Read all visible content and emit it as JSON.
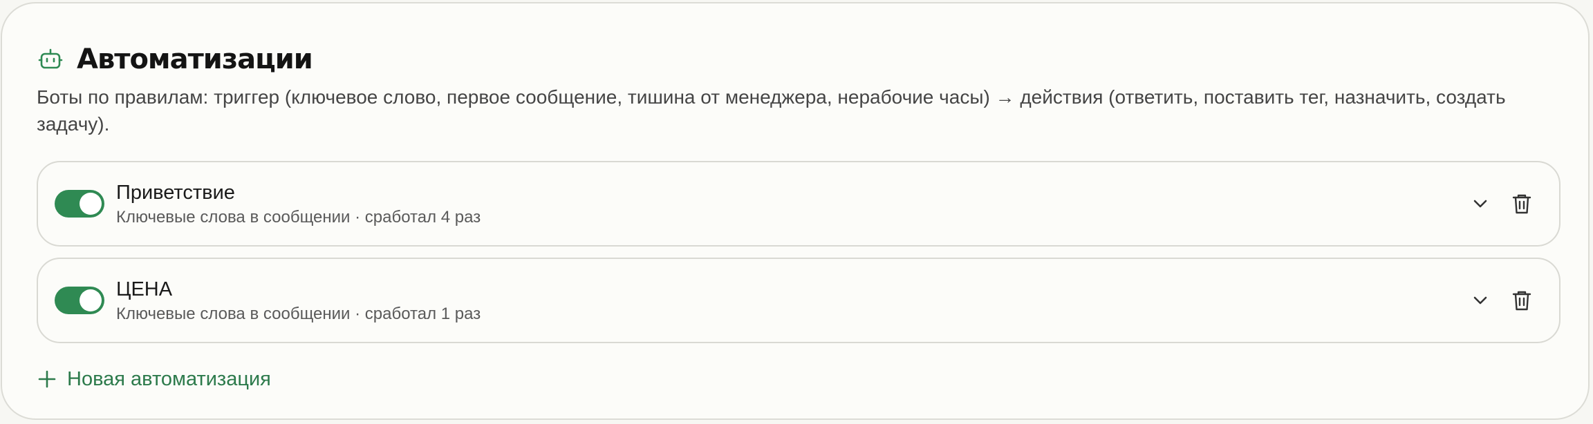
{
  "header": {
    "icon": "robot-icon",
    "title": "Автоматизации",
    "description": "Боты по правилам: триггер (ключевое слово, первое сообщение, тишина от менеджера, нерабочие часы) → действия (ответить, поставить тег, назначить, создать задачу)."
  },
  "rules": [
    {
      "enabled": true,
      "name": "Приветствие",
      "meta": "Ключевые слова в сообщении · сработал 4 раз"
    },
    {
      "enabled": true,
      "name": "ЦЕНА",
      "meta": "Ключевые слова в сообщении · сработал 1 раз"
    }
  ],
  "actions": {
    "add_label": "Новая автоматизация",
    "expand_icon": "chevron-down-icon",
    "delete_icon": "trash-icon",
    "add_icon": "plus-icon"
  },
  "colors": {
    "accent": "#2f8a53",
    "accent_text": "#2c7a4b",
    "background": "#fcfcf9",
    "border": "#d9d9d3"
  }
}
